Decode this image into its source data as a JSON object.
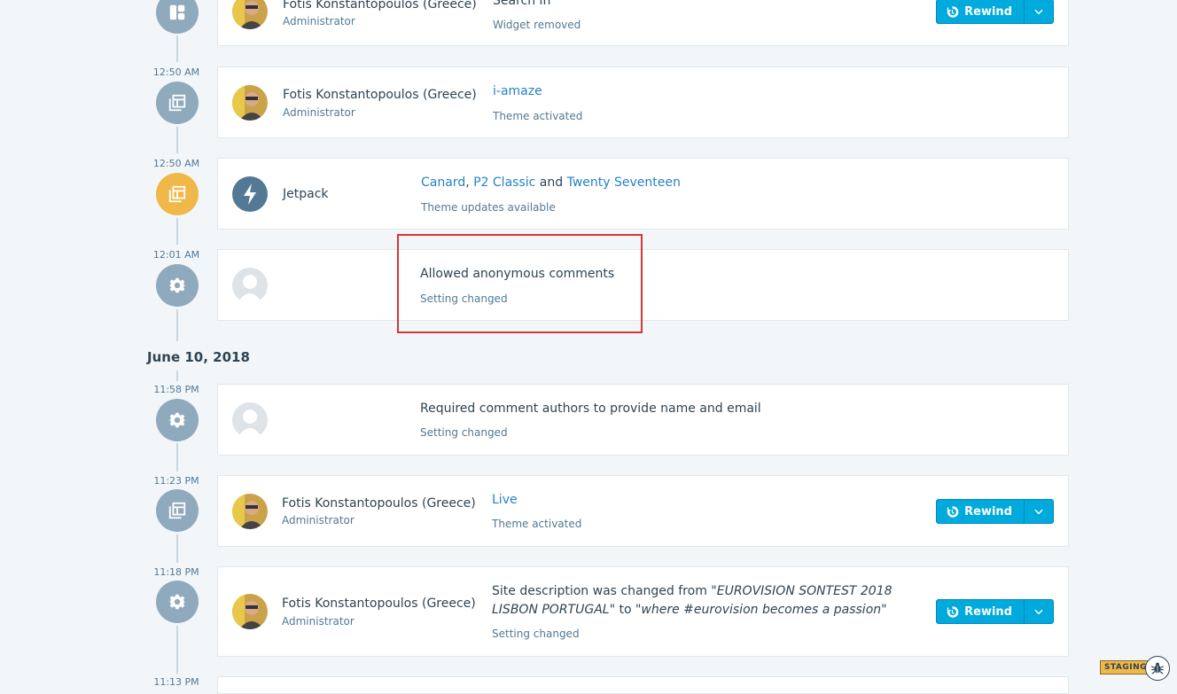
{
  "colors": {
    "accent": "#00aadc",
    "link": "#2483c4",
    "node_gray": "#8fa9bd",
    "node_yellow": "#f0b849",
    "highlight": "#d63638"
  },
  "rewind_label": "Rewind",
  "date_heading": "June 10, 2018",
  "events": [
    {
      "time": "",
      "icon": "layout-icon",
      "actor": {
        "name": "Fotis Konstantopoulos (Greece)",
        "role": "Administrator"
      },
      "title": "Search in",
      "subtitle": "Widget removed",
      "rewind": true
    },
    {
      "time": "12:50 AM",
      "icon": "themes-icon",
      "actor": {
        "name": "Fotis Konstantopoulos (Greece)",
        "role": "Administrator"
      },
      "title_link": "i-amaze",
      "subtitle": "Theme activated",
      "rewind": false
    },
    {
      "time": "12:50 AM",
      "icon": "themes-icon",
      "actor": {
        "name": "Jetpack",
        "role": ""
      },
      "title_parts": {
        "link1": "Canard",
        "sep1": ", ",
        "link2": "P2 Classic",
        "sep2": " and ",
        "link3": "Twenty Seventeen"
      },
      "subtitle": "Theme updates available",
      "rewind": false
    },
    {
      "time": "12:01 AM",
      "icon": "cog-icon",
      "title": "Allowed anonymous comments",
      "subtitle": "Setting changed",
      "rewind": false
    },
    {
      "time": "11:58 PM",
      "icon": "cog-icon",
      "title": "Required comment authors to provide name and email",
      "subtitle": "Setting changed",
      "rewind": false
    },
    {
      "time": "11:23 PM",
      "icon": "themes-icon",
      "actor": {
        "name": "Fotis Konstantopoulos (Greece)",
        "role": "Administrator"
      },
      "title_link": "Live",
      "subtitle": "Theme activated",
      "rewind": true
    },
    {
      "time": "11:18 PM",
      "icon": "cog-icon",
      "actor": {
        "name": "Fotis Konstantopoulos (Greece)",
        "role": "Administrator"
      },
      "title_parts": {
        "t1": "Site description was changed from \"",
        "q1": "EUROVISION SONTEST 2018 LISBON PORTUGAL",
        "t2": "\" to \"",
        "q2": "where #eurovision becomes a passion",
        "t3": "\""
      },
      "subtitle": "Setting changed",
      "rewind": true
    },
    {
      "time": "11:13 PM"
    }
  ],
  "staging_badge": "STAGING"
}
